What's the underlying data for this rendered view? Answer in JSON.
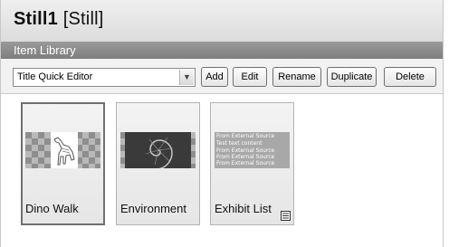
{
  "window": {
    "title_bold": "Still1",
    "title_rest": " [Still]"
  },
  "library": {
    "header": "Item Library"
  },
  "toolbar": {
    "selected_editor": "Title Quick Editor",
    "buttons": {
      "add": "Add",
      "edit": "Edit",
      "rename": "Rename",
      "duplicate": "Duplicate",
      "delete": "Delete"
    }
  },
  "items": [
    {
      "label": "Dino Walk",
      "selected": true,
      "thumb": "dinosaur-skeleton-thumbnail"
    },
    {
      "label": "Environment",
      "selected": false,
      "thumb": "nautilus-shell-thumbnail"
    },
    {
      "label": "Exhibit List",
      "selected": false,
      "thumb": "text-list-thumbnail",
      "thumb_lines": [
        "From External Source",
        "Test text content",
        "From External Source",
        "From External Source",
        "From External Source"
      ],
      "icon": "document-icon"
    }
  ]
}
